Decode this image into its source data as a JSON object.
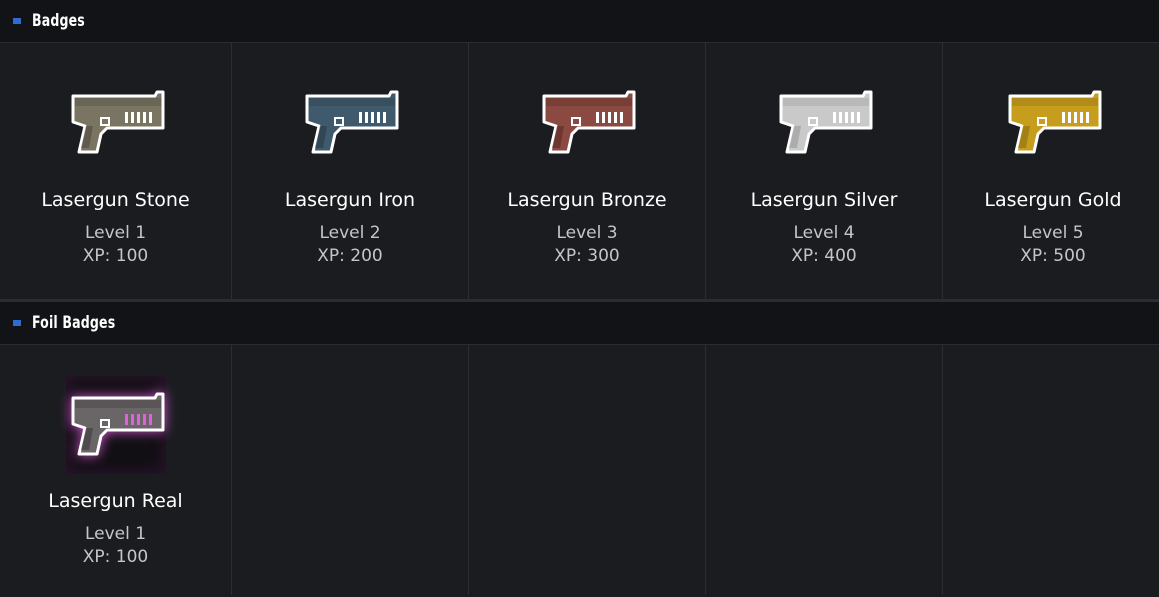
{
  "sections": [
    {
      "title": "Badges",
      "badges": [
        {
          "name": "Lasergun Stone",
          "level": "Level 1",
          "xp": "XP: 100",
          "icon": "lasergun-icon",
          "color": "#7a7563",
          "color_dark": "#4e4a3d",
          "vent": "#ffffff"
        },
        {
          "name": "Lasergun Iron",
          "level": "Level 2",
          "xp": "XP: 200",
          "icon": "lasergun-icon",
          "color": "#3f5a6c",
          "color_dark": "#283b48",
          "vent": "#ffffff"
        },
        {
          "name": "Lasergun Bronze",
          "level": "Level 3",
          "xp": "XP: 300",
          "icon": "lasergun-icon",
          "color": "#8a4a41",
          "color_dark": "#5a2b25",
          "vent": "#ffffff"
        },
        {
          "name": "Lasergun Silver",
          "level": "Level 4",
          "xp": "XP: 400",
          "icon": "lasergun-icon",
          "color": "#c9c9c9",
          "color_dark": "#9a9a9a",
          "vent": "#ffffff"
        },
        {
          "name": "Lasergun Gold",
          "level": "Level 5",
          "xp": "XP: 500",
          "icon": "lasergun-icon",
          "color": "#c79d1e",
          "color_dark": "#8c6a0d",
          "vent": "#ffffff"
        }
      ]
    },
    {
      "title": "Foil Badges",
      "badges": [
        {
          "name": "Lasergun Real",
          "level": "Level 1",
          "xp": "XP: 100",
          "icon": "lasergun-foil-icon",
          "color": "#6a6566",
          "color_dark": "#3d393a",
          "vent": "#e060e0"
        }
      ]
    }
  ],
  "colors": {
    "accent": "#2f6bd1",
    "header_bg": "#121316",
    "cell_bg": "#1b1c20"
  }
}
